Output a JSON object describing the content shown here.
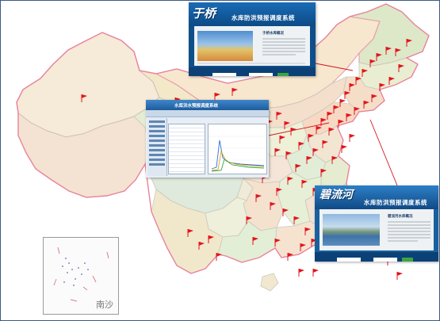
{
  "map": {
    "south_sea_inset_label": "南沙",
    "marker_color": "#e3141c",
    "connector_color": "#d4141c"
  },
  "screenshots": {
    "top": {
      "logo_text": "于桥",
      "system_name": "水库防洪预报调度系统",
      "panel_title": "于桥水库概况"
    },
    "middle": {
      "system_name": "水库洪水预报调度系统"
    },
    "right": {
      "logo_text": "碧流河",
      "system_name": "水库防洪预报调度系统",
      "panel_title": "碧流河水库概况"
    }
  }
}
